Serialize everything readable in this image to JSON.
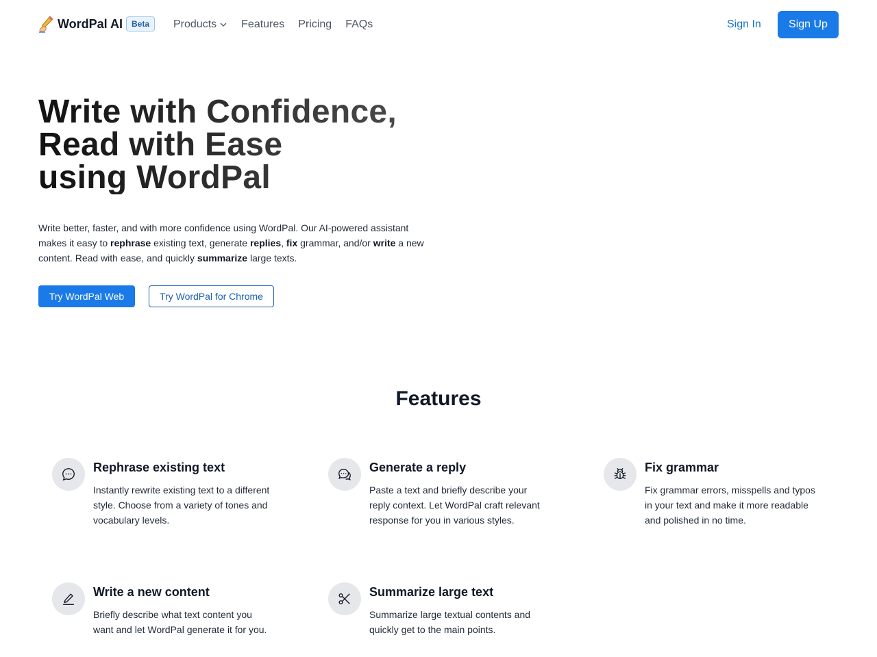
{
  "nav": {
    "brand": "WordPal AI",
    "beta": "Beta",
    "links": [
      {
        "label": "Products",
        "dropdown": true
      },
      {
        "label": "Features"
      },
      {
        "label": "Pricing"
      },
      {
        "label": "FAQs"
      }
    ],
    "sign_in": "Sign In",
    "sign_up": "Sign Up"
  },
  "hero": {
    "title_lines": [
      "Write with Confidence,",
      "Read with Ease",
      "using WordPal"
    ],
    "desc_parts": [
      "Write better, faster, and with more confidence using WordPal. Our AI-powered assistant makes it easy to ",
      "rephrase",
      " existing text, generate ",
      "replies",
      ", ",
      "fix",
      " grammar, and/or ",
      "write",
      " a new content. Read with ease, and quickly ",
      "summarize",
      " large texts."
    ],
    "primary_cta": "Try WordPal Web",
    "secondary_cta": "Try WordPal for Chrome"
  },
  "features": {
    "title": "Features",
    "items": [
      {
        "icon": "chat-bubble-dots-icon",
        "title": "Rephrase existing text",
        "desc": "Instantly rewrite existing text to a different style. Choose from a variety of tones and vocabulary levels."
      },
      {
        "icon": "chat-bubbles-icon",
        "title": "Generate a reply",
        "desc": "Paste a text and briefly describe your reply context. Let WordPal craft relevant response for you in various styles."
      },
      {
        "icon": "bug-icon",
        "title": "Fix grammar",
        "desc": "Fix grammar errors, misspells and typos in your text and make it more readable and polished in no time."
      },
      {
        "icon": "pencil-icon",
        "title": "Write a new content",
        "desc": "Briefly describe what text content you want and let WordPal generate it for you."
      },
      {
        "icon": "scissors-icon",
        "title": "Summarize large text",
        "desc": "Summarize large textual contents and quickly get to the main points."
      }
    ]
  },
  "colors": {
    "primary": "#1a7ae8",
    "link": "#1a73c9",
    "icon_bg": "#e5e7eb"
  }
}
